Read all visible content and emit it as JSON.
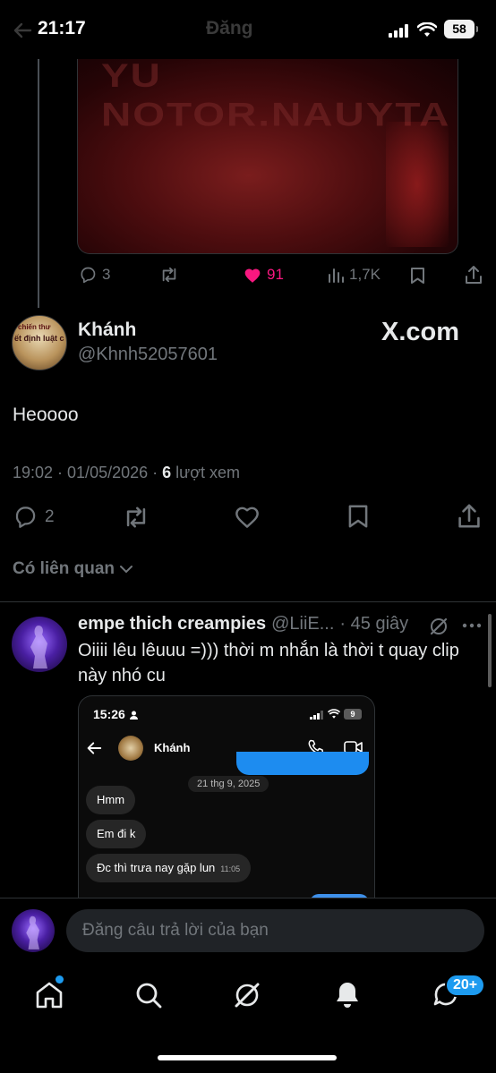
{
  "status_bar": {
    "time": "21:17",
    "title": "Đăng",
    "battery": "58"
  },
  "top_media": {
    "watermark_text": "YU NOTOR.NAUYTA"
  },
  "top_actions": {
    "replies": "3",
    "likes": "91",
    "views": "1,7K"
  },
  "tweet": {
    "author_name": "Khánh",
    "author_handle": "@Khnh52057601",
    "avatar_text_1": "chiến thư",
    "avatar_text_2": "ết định luật c",
    "watermark": "X.com",
    "text": "Heoooo",
    "meta_prefix": "19:02 · 01/05/2026 · ",
    "meta_views": "6",
    "meta_suffix": " lượt xem",
    "actions": {
      "replies": "2"
    }
  },
  "related_label": "Có liên quan",
  "reply": {
    "name": "empe thich creampies",
    "handle": "@LiiE...",
    "time": "· 45 giây",
    "text": "Oiiii lêu lêuuu =))) thời m nhắn là thời t quay clip này nhó cu",
    "embed": {
      "time": "15:26",
      "battery": "9",
      "contact_name": "Khánh",
      "date_chip": "21 thg 9, 2025",
      "messages": [
        {
          "text": "Hmm",
          "time": ""
        },
        {
          "text": "Em đi k",
          "time": ""
        },
        {
          "text": "Đc thì trưa nay gặp lun",
          "time": "11:05"
        }
      ]
    }
  },
  "composer": {
    "placeholder": "Đăng câu trả lời của bạn"
  },
  "bottom_nav": {
    "messages_badge": "20+"
  },
  "colors": {
    "accent": "#1d9bf0",
    "like": "#f91880",
    "muted": "#71767b",
    "background": "#000000"
  }
}
